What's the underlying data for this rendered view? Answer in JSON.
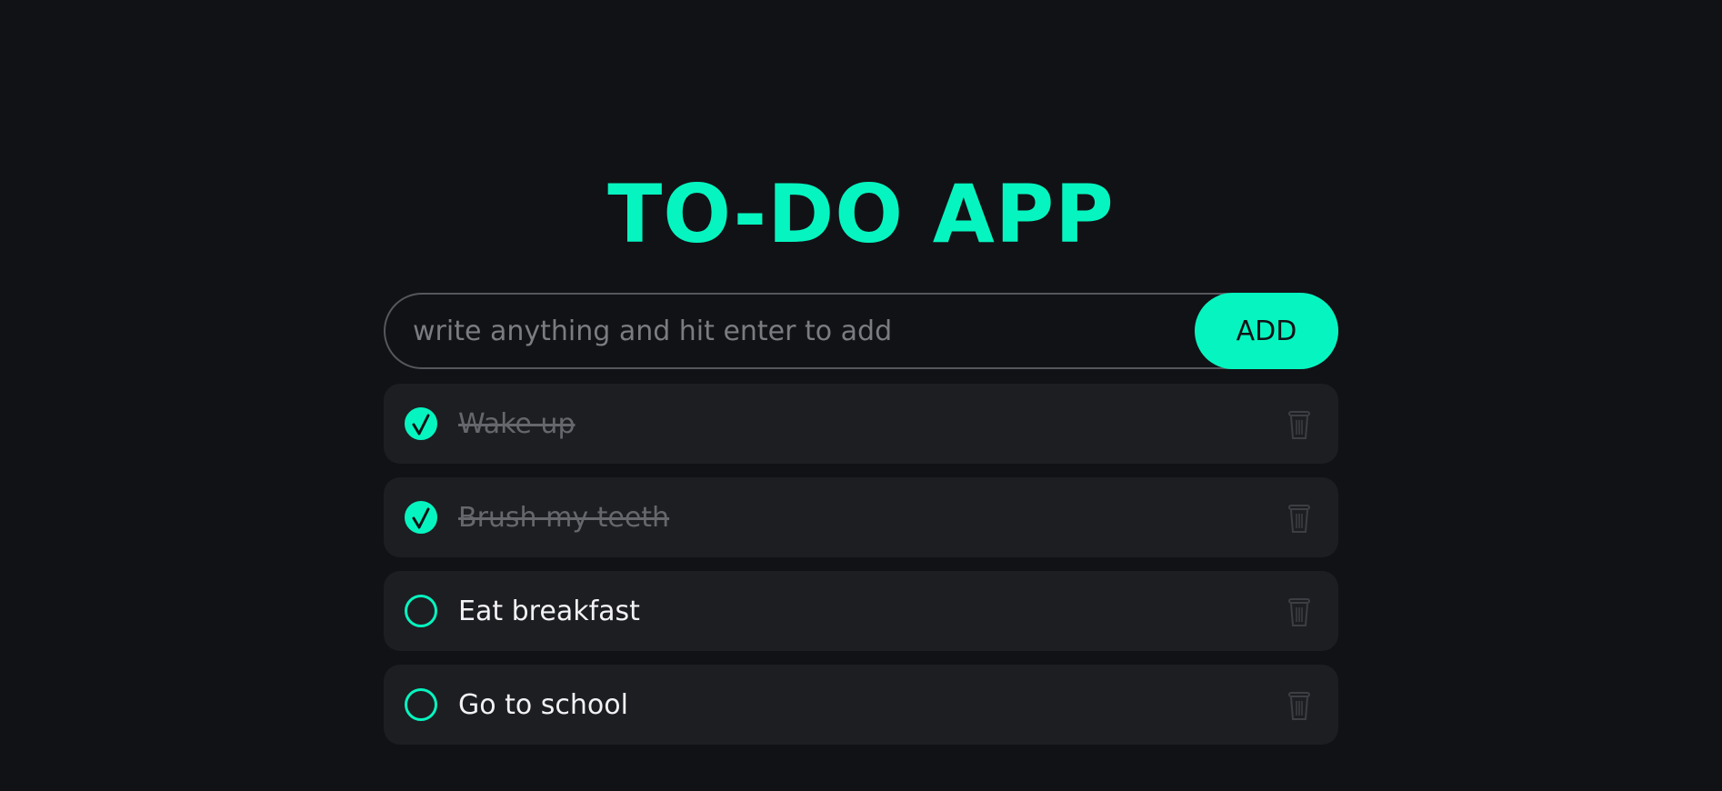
{
  "app": {
    "title": "TO-DO APP"
  },
  "input": {
    "placeholder": "write anything and hit enter to add",
    "value": ""
  },
  "add_button": {
    "label": "ADD"
  },
  "todos": [
    {
      "text": "Wake up",
      "completed": true
    },
    {
      "text": "Brush my teeth",
      "completed": true
    },
    {
      "text": "Eat breakfast",
      "completed": false
    },
    {
      "text": "Go to school",
      "completed": false
    }
  ],
  "icons": {
    "check": "checkmark-icon",
    "delete": "trash-icon"
  },
  "colors": {
    "accent": "#06f5c0",
    "background": "#111216",
    "card": "#1d1e22",
    "done_text": "#65676c"
  }
}
